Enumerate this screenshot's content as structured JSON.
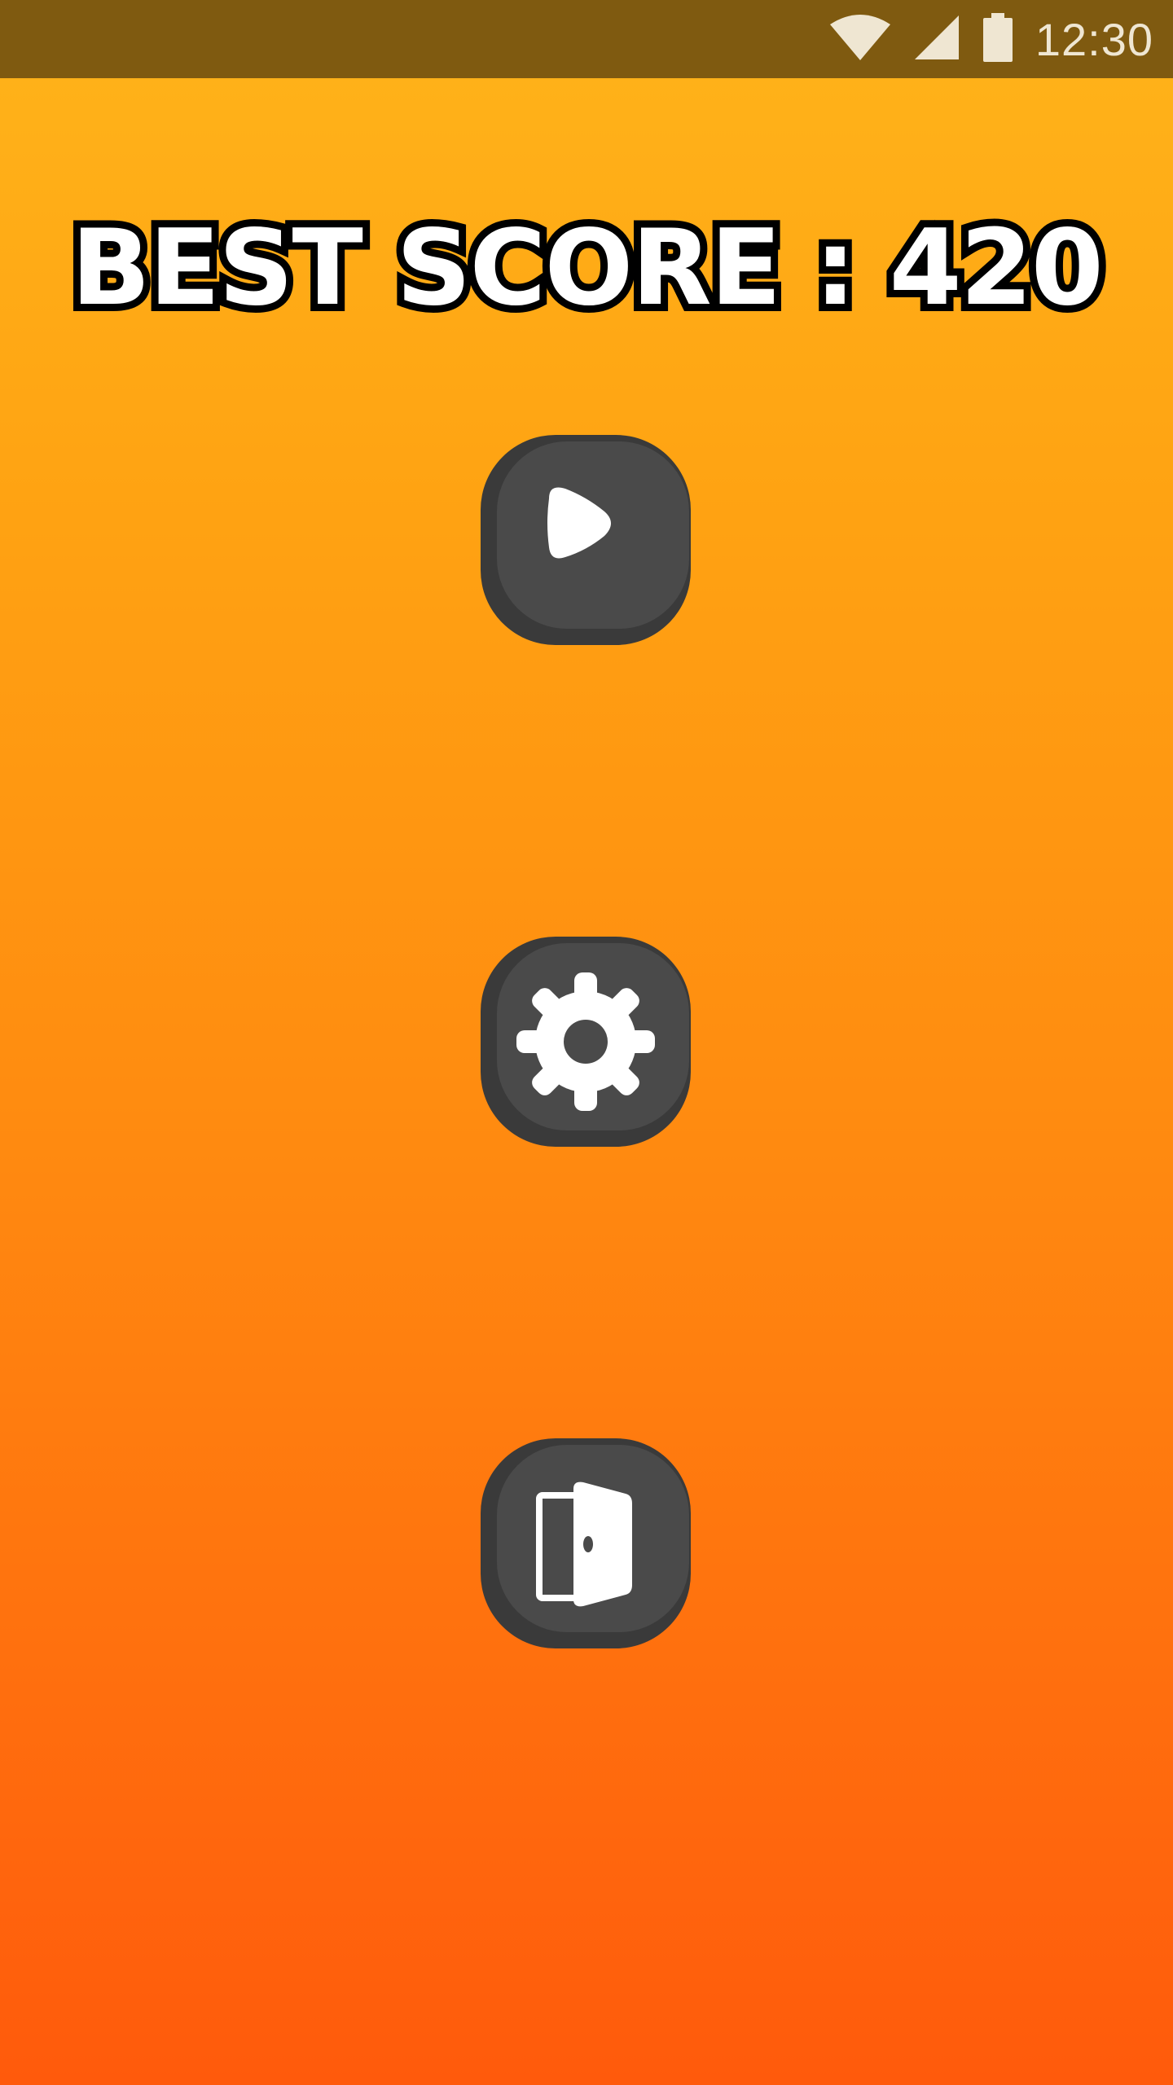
{
  "status_bar": {
    "time": "12:30",
    "icons": [
      "wifi-icon",
      "cell-signal-icon",
      "battery-icon"
    ],
    "background": "#7f5a10"
  },
  "score": {
    "label": "BEST SCORE : 420",
    "value": 420
  },
  "menu": {
    "buttons": [
      {
        "name": "play-button",
        "icon": "play-icon"
      },
      {
        "name": "settings-button",
        "icon": "gear-icon"
      },
      {
        "name": "exit-button",
        "icon": "door-exit-icon"
      }
    ],
    "button_color": "#4a4a4a",
    "icon_color": "#ffffff"
  },
  "colors": {
    "background_top": "#ffb41a",
    "background_bottom": "#ff5a0c",
    "title_fill": "#ffffff",
    "title_outline": "#000000"
  }
}
